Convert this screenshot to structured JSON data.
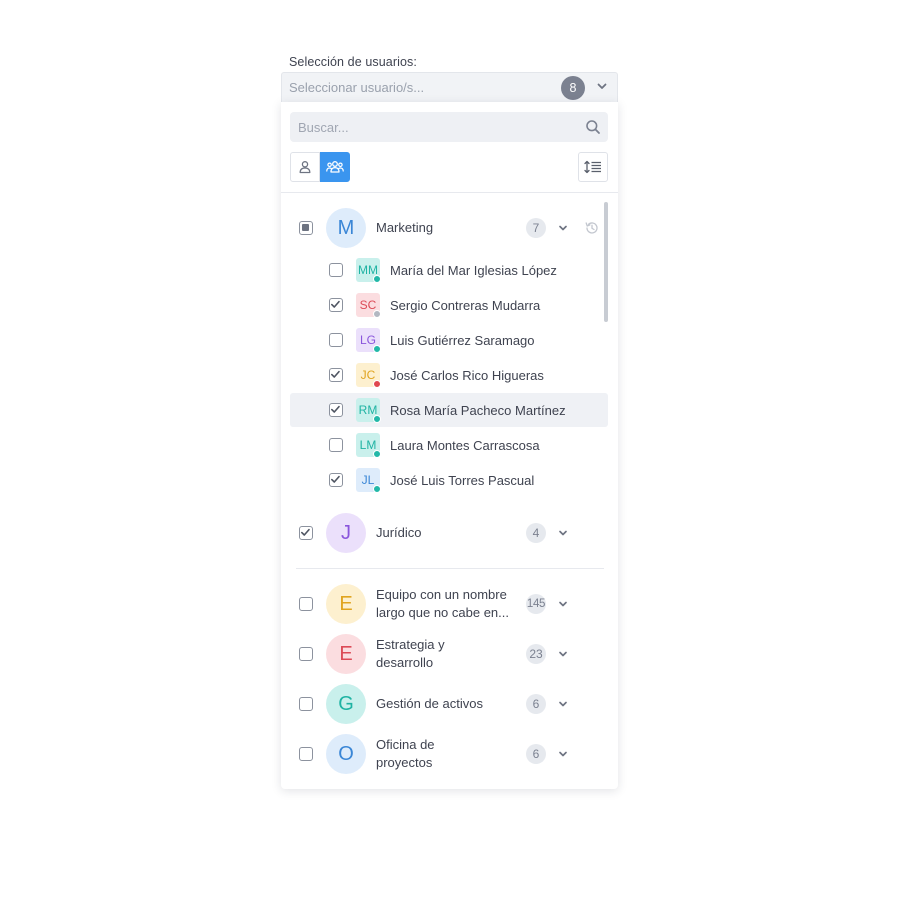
{
  "field": {
    "label": "Selección de usuarios:",
    "placeholder": "Seleccionar usuario/s...",
    "selected_count": "8"
  },
  "search": {
    "placeholder": "Buscar..."
  },
  "toolbar": {
    "user_mode_icon": "user-icon",
    "group_mode_icon": "users-group-icon",
    "sort_icon": "sort-list-icon",
    "active": "group"
  },
  "colors": {
    "accent": "#3a95ef",
    "badge": "#7b8190",
    "status_online": "#22b8a8",
    "status_busy": "#e0474f",
    "status_offline": "#b3b8c2"
  },
  "groups": [
    {
      "initial": "M",
      "name": "Marketing",
      "count": "7",
      "state": "partial",
      "expanded": true,
      "history_icon": "history-icon",
      "members": [
        {
          "initials": "MM",
          "name": "María del Mar Iglesias López",
          "checked": false,
          "status": "online"
        },
        {
          "initials": "SC",
          "name": "Sergio Contreras Mudarra",
          "checked": true,
          "status": "offline"
        },
        {
          "initials": "LG",
          "name": "Luis Gutiérrez Saramago",
          "checked": false,
          "status": "online"
        },
        {
          "initials": "JC",
          "name": "José Carlos Rico Higueras",
          "checked": true,
          "status": "busy"
        },
        {
          "initials": "RM",
          "name": "Rosa María Pacheco Martínez",
          "checked": true,
          "status": "online"
        },
        {
          "initials": "LM",
          "name": "Laura Montes Carrascosa",
          "checked": false,
          "status": "online"
        },
        {
          "initials": "JL",
          "name": "José Luis Torres Pascual",
          "checked": true,
          "status": "online"
        }
      ]
    },
    {
      "initial": "J",
      "name": "Jurídico",
      "count": "4",
      "state": "checked"
    },
    {
      "initial": "E",
      "name": "Equipo con un nombre largo que no cabe en...",
      "count": "145",
      "state": "unchecked"
    },
    {
      "initial": "E",
      "name": "Estrategia y desarrollo",
      "count": "23",
      "state": "unchecked"
    },
    {
      "initial": "G",
      "name": "Gestión de activos",
      "count": "6",
      "state": "unchecked"
    },
    {
      "initial": "O",
      "name": "Oficina de proyectos",
      "count": "6",
      "state": "unchecked"
    }
  ]
}
